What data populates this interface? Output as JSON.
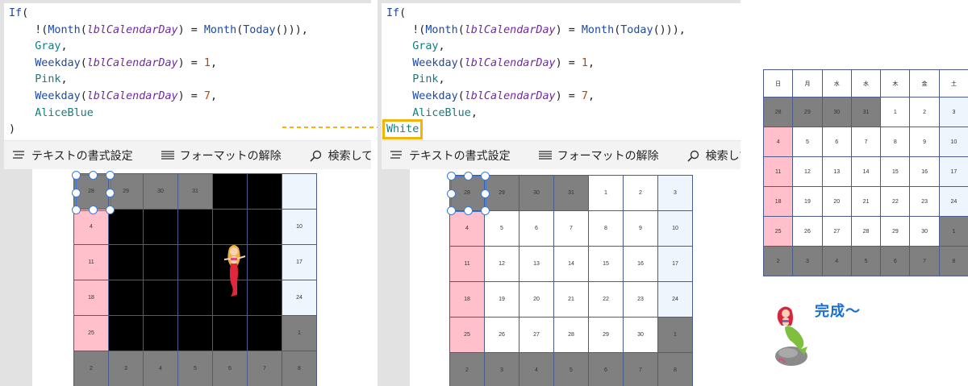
{
  "left_panel": {
    "code_lines": [
      [
        {
          "t": "If",
          "c": "kw"
        },
        {
          "t": "(",
          "c": "pl"
        }
      ],
      [
        {
          "t": "    !(",
          "c": "pl"
        },
        {
          "t": "Month",
          "c": "fn"
        },
        {
          "t": "(",
          "c": "pl"
        },
        {
          "t": "lblCalendarDay",
          "c": "ctl"
        },
        {
          "t": ") = ",
          "c": "pl"
        },
        {
          "t": "Month",
          "c": "fn"
        },
        {
          "t": "(",
          "c": "pl"
        },
        {
          "t": "Today",
          "c": "fn"
        },
        {
          "t": "())),",
          "c": "pl"
        }
      ],
      [
        {
          "t": "    ",
          "c": "pl"
        },
        {
          "t": "Gray",
          "c": "col"
        },
        {
          "t": ",",
          "c": "pl"
        }
      ],
      [
        {
          "t": "    ",
          "c": "pl"
        },
        {
          "t": "Weekday",
          "c": "fn"
        },
        {
          "t": "(",
          "c": "pl"
        },
        {
          "t": "lblCalendarDay",
          "c": "ctl"
        },
        {
          "t": ") = ",
          "c": "pl"
        },
        {
          "t": "1",
          "c": "num"
        },
        {
          "t": ",",
          "c": "pl"
        }
      ],
      [
        {
          "t": "    ",
          "c": "pl"
        },
        {
          "t": "Pink",
          "c": "col"
        },
        {
          "t": ",",
          "c": "pl"
        }
      ],
      [
        {
          "t": "    ",
          "c": "pl"
        },
        {
          "t": "Weekday",
          "c": "fn"
        },
        {
          "t": "(",
          "c": "pl"
        },
        {
          "t": "lblCalendarDay",
          "c": "ctl"
        },
        {
          "t": ") = ",
          "c": "pl"
        },
        {
          "t": "7",
          "c": "num"
        },
        {
          "t": ",",
          "c": "pl"
        }
      ],
      [
        {
          "t": "    ",
          "c": "pl"
        },
        {
          "t": "AliceBlue",
          "c": "col"
        }
      ],
      [
        {
          "t": ")",
          "c": "pl"
        }
      ]
    ],
    "rows": [
      [
        "28",
        "29",
        "30",
        "31",
        "",
        "",
        ""
      ],
      [
        "4",
        "",
        "",
        "",
        "",
        "",
        "10"
      ],
      [
        "11",
        "",
        "",
        "",
        "",
        "",
        "17"
      ],
      [
        "18",
        "",
        "",
        "",
        "",
        "",
        "24"
      ],
      [
        "25",
        "",
        "",
        "",
        "",
        "",
        "1"
      ],
      [
        "2",
        "3",
        "4",
        "5",
        "6",
        "7",
        "8"
      ]
    ],
    "colors": [
      [
        "g",
        "g",
        "g",
        "g",
        "k",
        "k",
        "b"
      ],
      [
        "p",
        "k",
        "k",
        "k",
        "k",
        "k",
        "b"
      ],
      [
        "p",
        "k",
        "k",
        "k",
        "k",
        "k",
        "b"
      ],
      [
        "p",
        "k",
        "k",
        "k",
        "k",
        "k",
        "b"
      ],
      [
        "p",
        "k",
        "k",
        "k",
        "k",
        "k",
        "g"
      ],
      [
        "g",
        "g",
        "g",
        "g",
        "g",
        "g",
        "g"
      ]
    ]
  },
  "mid_panel": {
    "code_lines": [
      [
        {
          "t": "If",
          "c": "kw"
        },
        {
          "t": "(",
          "c": "pl"
        }
      ],
      [
        {
          "t": "    !(",
          "c": "pl"
        },
        {
          "t": "Month",
          "c": "fn"
        },
        {
          "t": "(",
          "c": "pl"
        },
        {
          "t": "lblCalendarDay",
          "c": "ctl"
        },
        {
          "t": ") = ",
          "c": "pl"
        },
        {
          "t": "Month",
          "c": "fn"
        },
        {
          "t": "(",
          "c": "pl"
        },
        {
          "t": "Today",
          "c": "fn"
        },
        {
          "t": "())),",
          "c": "pl"
        }
      ],
      [
        {
          "t": "    ",
          "c": "pl"
        },
        {
          "t": "Gray",
          "c": "col"
        },
        {
          "t": ",",
          "c": "pl"
        }
      ],
      [
        {
          "t": "    ",
          "c": "pl"
        },
        {
          "t": "Weekday",
          "c": "fn"
        },
        {
          "t": "(",
          "c": "pl"
        },
        {
          "t": "lblCalendarDay",
          "c": "ctl"
        },
        {
          "t": ") = ",
          "c": "pl"
        },
        {
          "t": "1",
          "c": "num"
        },
        {
          "t": ",",
          "c": "pl"
        }
      ],
      [
        {
          "t": "    ",
          "c": "pl"
        },
        {
          "t": "Pink",
          "c": "col"
        },
        {
          "t": ",",
          "c": "pl"
        }
      ],
      [
        {
          "t": "    ",
          "c": "pl"
        },
        {
          "t": "Weekday",
          "c": "fn"
        },
        {
          "t": "(",
          "c": "pl"
        },
        {
          "t": "lblCalendarDay",
          "c": "ctl"
        },
        {
          "t": ") = ",
          "c": "pl"
        },
        {
          "t": "7",
          "c": "num"
        },
        {
          "t": ",",
          "c": "pl"
        }
      ],
      [
        {
          "t": "    ",
          "c": "pl"
        },
        {
          "t": "AliceBlue",
          "c": "col"
        },
        {
          "t": ",",
          "c": "pl"
        }
      ],
      [
        {
          "t": "White",
          "c": "col hl"
        }
      ]
    ],
    "rows": [
      [
        "28",
        "29",
        "30",
        "31",
        "1",
        "2",
        "3"
      ],
      [
        "4",
        "5",
        "6",
        "7",
        "8",
        "9",
        "10"
      ],
      [
        "11",
        "12",
        "13",
        "14",
        "15",
        "16",
        "17"
      ],
      [
        "18",
        "19",
        "20",
        "21",
        "22",
        "23",
        "24"
      ],
      [
        "25",
        "26",
        "27",
        "28",
        "29",
        "30",
        "1"
      ],
      [
        "2",
        "3",
        "4",
        "5",
        "6",
        "7",
        "8"
      ]
    ],
    "colors": [
      [
        "g",
        "g",
        "g",
        "g",
        "w",
        "w",
        "b"
      ],
      [
        "p",
        "w",
        "w",
        "w",
        "w",
        "w",
        "b"
      ],
      [
        "p",
        "w",
        "w",
        "w",
        "w",
        "w",
        "b"
      ],
      [
        "p",
        "w",
        "w",
        "w",
        "w",
        "w",
        "b"
      ],
      [
        "p",
        "w",
        "w",
        "w",
        "w",
        "w",
        "g"
      ],
      [
        "g",
        "g",
        "g",
        "g",
        "g",
        "g",
        "g"
      ]
    ]
  },
  "toolbar": {
    "text_format": "テキストの書式設定",
    "clear_format": "フォーマットの解除",
    "find_replace": "検索して置換"
  },
  "right_calendar": {
    "headers": [
      "日",
      "月",
      "水",
      "水",
      "木",
      "金",
      "土"
    ],
    "rows": [
      [
        "28",
        "29",
        "30",
        "31",
        "1",
        "2",
        "3"
      ],
      [
        "4",
        "5",
        "6",
        "7",
        "8",
        "9",
        "10"
      ],
      [
        "11",
        "12",
        "13",
        "14",
        "15",
        "16",
        "17"
      ],
      [
        "18",
        "19",
        "20",
        "21",
        "22",
        "23",
        "24"
      ],
      [
        "25",
        "26",
        "27",
        "28",
        "29",
        "30",
        "1"
      ],
      [
        "2",
        "3",
        "4",
        "5",
        "6",
        "7",
        "8"
      ]
    ],
    "colors": [
      [
        "g",
        "g",
        "g",
        "g",
        "w",
        "w",
        "b"
      ],
      [
        "p",
        "w",
        "w",
        "w",
        "w",
        "w",
        "b"
      ],
      [
        "p",
        "w",
        "w",
        "w",
        "w",
        "w",
        "b"
      ],
      [
        "p",
        "w",
        "w",
        "w",
        "w",
        "w",
        "b"
      ],
      [
        "p",
        "w",
        "w",
        "w",
        "w",
        "w",
        "g"
      ],
      [
        "g",
        "g",
        "g",
        "g",
        "g",
        "g",
        "g"
      ]
    ]
  },
  "caption": "完成～",
  "palette": {
    "gray": "#808080",
    "pink": "#ffc0cb",
    "aliceblue": "#eef5fd",
    "white": "#ffffff",
    "black": "#000000",
    "highlight": "#f5b30a",
    "selection": "#3b7ad9"
  }
}
